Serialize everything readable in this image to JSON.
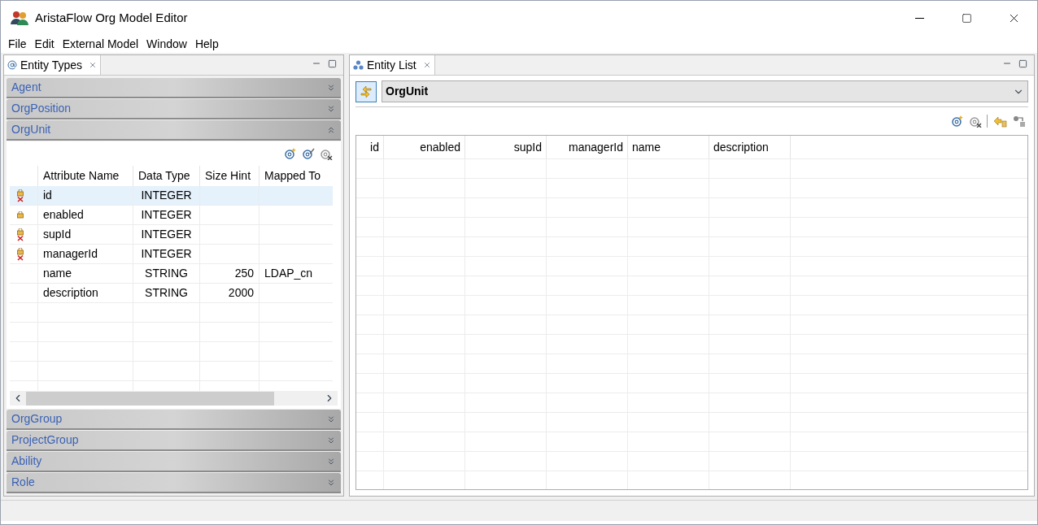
{
  "window": {
    "title": "AristaFlow Org Model Editor"
  },
  "menu": [
    "File",
    "Edit",
    "External Model",
    "Window",
    "Help"
  ],
  "left_panel": {
    "tab": "Entity Types",
    "sections": [
      {
        "label": "Agent",
        "expanded": false
      },
      {
        "label": "OrgPosition",
        "expanded": false
      },
      {
        "label": "OrgUnit",
        "expanded": true
      },
      {
        "label": "OrgGroup",
        "expanded": false
      },
      {
        "label": "ProjectGroup",
        "expanded": false
      },
      {
        "label": "Ability",
        "expanded": false
      },
      {
        "label": "Role",
        "expanded": false
      }
    ],
    "attribute_table": {
      "columns": [
        "Attribute Name",
        "Data Type",
        "Size Hint",
        "Mapped To"
      ],
      "rows": [
        {
          "name": "id",
          "data_type": "INTEGER",
          "locked": true,
          "marked": true,
          "selected": true
        },
        {
          "name": "enabled",
          "data_type": "INTEGER",
          "locked": true,
          "marked": false,
          "selected": false
        },
        {
          "name": "supId",
          "data_type": "INTEGER",
          "locked": true,
          "marked": true,
          "selected": false
        },
        {
          "name": "managerId",
          "data_type": "INTEGER",
          "locked": true,
          "marked": true,
          "selected": false
        },
        {
          "name": "name",
          "data_type": "STRING",
          "size_hint": "250",
          "mapped_to": "LDAP_cn",
          "locked": false,
          "marked": false,
          "selected": false
        },
        {
          "name": "description",
          "data_type": "STRING",
          "size_hint": "2000",
          "locked": false,
          "marked": false,
          "selected": false
        }
      ]
    }
  },
  "right_panel": {
    "tab": "Entity List",
    "entity_type": "OrgUnit",
    "table": {
      "columns": [
        "id",
        "enabled",
        "supId",
        "managerId",
        "name",
        "description"
      ]
    }
  }
}
